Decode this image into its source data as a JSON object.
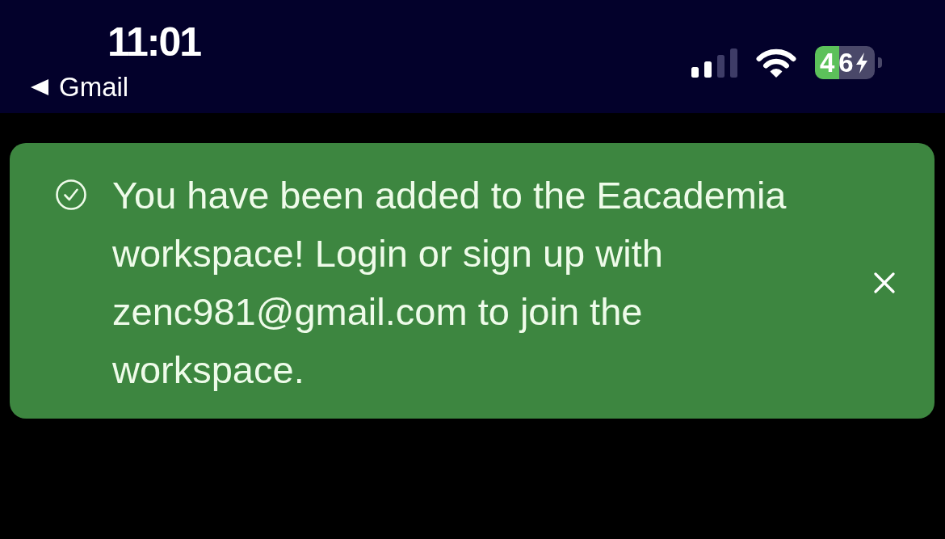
{
  "status_bar": {
    "time": "11:01",
    "back_label": "Gmail",
    "battery": {
      "percent_text": "46",
      "charging": true
    }
  },
  "toast": {
    "kind": "success",
    "message": "You have been added to the Eacademia workspace! Login or sign up with zenc981@gmail.com to join the workspace.",
    "dismissible": true
  }
}
